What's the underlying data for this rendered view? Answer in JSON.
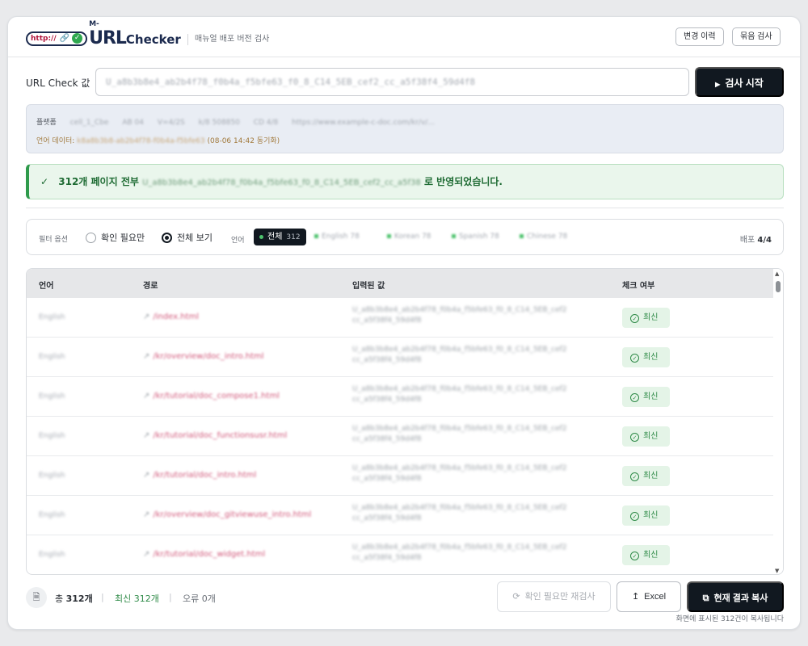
{
  "header": {
    "logo_http": "http://",
    "logo_m": "M-",
    "logo_url": "URL",
    "logo_checker": "Checker",
    "subtitle": "매뉴얼 배포 버전 검사",
    "history_button": "변경 이력",
    "batch_button": "묶음 검사"
  },
  "url_check": {
    "label": "URL Check 값",
    "value": "U_a8b3b8e4_ab2b4f78_f0b4a_f5bfe63_f0_8_C14_5EB_cef2_cc_a5f38f4_59d4f8",
    "start_button": "검사 시작"
  },
  "info": {
    "platform_label": "플랫폼",
    "platform_items": [
      "cell_1_Cbe",
      "AB 04",
      "V=4/2S",
      "k/8 508850",
      "CD 4/8",
      "https://www.example-c-doc.com/kr/v/..."
    ],
    "lang_data_label": "언어 데이터:",
    "lang_data_value": "k8a8b3b8-ab2b4f78-f0b4a-f5bfe63",
    "sync_time": "(08-06 14:42 동기화)"
  },
  "banner": {
    "check": "✓",
    "prefix": "312개 페이지 전부",
    "value": "U_a8b3b8e4_ab2b4f78_f0b4a_f5bfe63_f0_8_C14_5EB_cef2_cc_a5f38",
    "suffix": "로 반영되었습니다."
  },
  "filter": {
    "label": "필터 옵션",
    "option_needs_check": "확인 필요만",
    "option_all": "전체 보기",
    "lang_label": "언어",
    "chip_all_label": "전체",
    "chip_all_count": "312",
    "chips": [
      "English 78",
      "Korean 78",
      "Spanish 78",
      "Chinese 78"
    ],
    "deploy_label": "배포",
    "deploy_value": "4/4"
  },
  "table": {
    "headers": [
      "언어",
      "경로",
      "입력된 값",
      "체크 여부"
    ],
    "rows": [
      {
        "lang": "English",
        "path": "/index.html",
        "value1": "U_a8b3b8e4_ab2b4f78_f0b4a_f5bfe63_f0_8_C14_5EB_cef2",
        "value2": "cc_a5f38f4_59d4f8",
        "status": "최신"
      },
      {
        "lang": "English",
        "path": "/kr/overview/doc_intro.html",
        "value1": "U_a8b3b8e4_ab2b4f78_f0b4a_f5bfe63_f0_8_C14_5EB_cef2",
        "value2": "cc_a5f38f4_59d4f8",
        "status": "최신"
      },
      {
        "lang": "English",
        "path": "/kr/tutorial/doc_compose1.html",
        "value1": "U_a8b3b8e4_ab2b4f78_f0b4a_f5bfe63_f0_8_C14_5EB_cef2",
        "value2": "cc_a5f38f4_59d4f8",
        "status": "최신"
      },
      {
        "lang": "English",
        "path": "/kr/tutorial/doc_functionsusr.html",
        "value1": "U_a8b3b8e4_ab2b4f78_f0b4a_f5bfe63_f0_8_C14_5EB_cef2",
        "value2": "cc_a5f38f4_59d4f8",
        "status": "최신"
      },
      {
        "lang": "English",
        "path": "/kr/tutorial/doc_intro.html",
        "value1": "U_a8b3b8e4_ab2b4f78_f0b4a_f5bfe63_f0_8_C14_5EB_cef2",
        "value2": "cc_a5f38f4_59d4f8",
        "status": "최신"
      },
      {
        "lang": "English",
        "path": "/kr/overview/doc_gitviewuse_intro.html",
        "value1": "U_a8b3b8e4_ab2b4f78_f0b4a_f5bfe63_f0_8_C14_5EB_cef2",
        "value2": "cc_a5f38f4_59d4f8",
        "status": "최신"
      },
      {
        "lang": "English",
        "path": "/kr/tutorial/doc_widget.html",
        "value1": "U_a8b3b8e4_ab2b4f78_f0b4a_f5bfe63_f0_8_C14_5EB_cef2",
        "value2": "cc_a5f38f4_59d4f8",
        "status": "최신"
      }
    ]
  },
  "footer": {
    "total_label": "총",
    "total_value": "312개",
    "latest_label": "최신",
    "latest_value": "312개",
    "error_label": "오류",
    "error_value": "0개",
    "retry_button": "확인 필요만 재검사",
    "excel_button": "Excel",
    "copy_button": "현재 결과 복사",
    "copy_hint": "화면에 표시된 312건이 복사됩니다"
  },
  "colors": {
    "primary_dark": "#111820",
    "success_green": "#2e8a47",
    "path_pink": "#d1587a",
    "brand_navy": "#1b2a4e",
    "brand_red": "#b0123a"
  }
}
